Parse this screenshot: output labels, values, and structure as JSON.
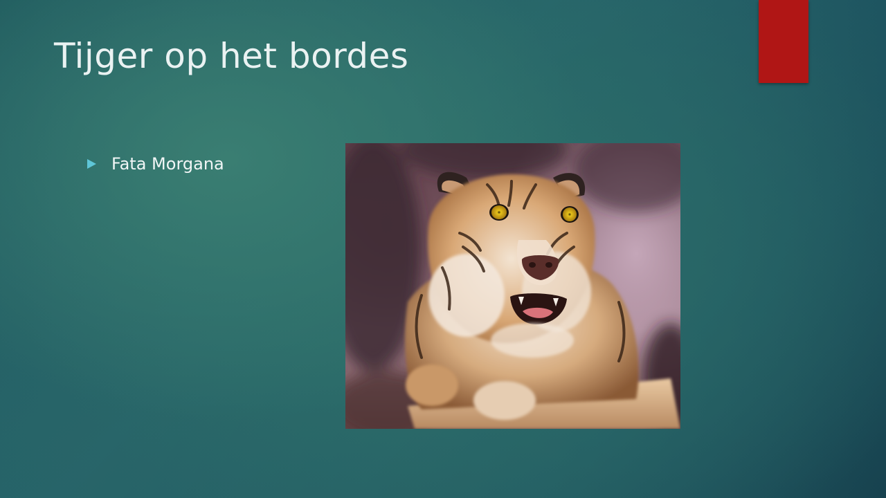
{
  "slide": {
    "title": "Tijger op het bordes",
    "bullets": [
      {
        "text": "Fata Morgana"
      }
    ],
    "accent_color": "#b01615",
    "bullet_color": "#5fc6d8"
  },
  "image": {
    "subject": "tiger-photo"
  }
}
